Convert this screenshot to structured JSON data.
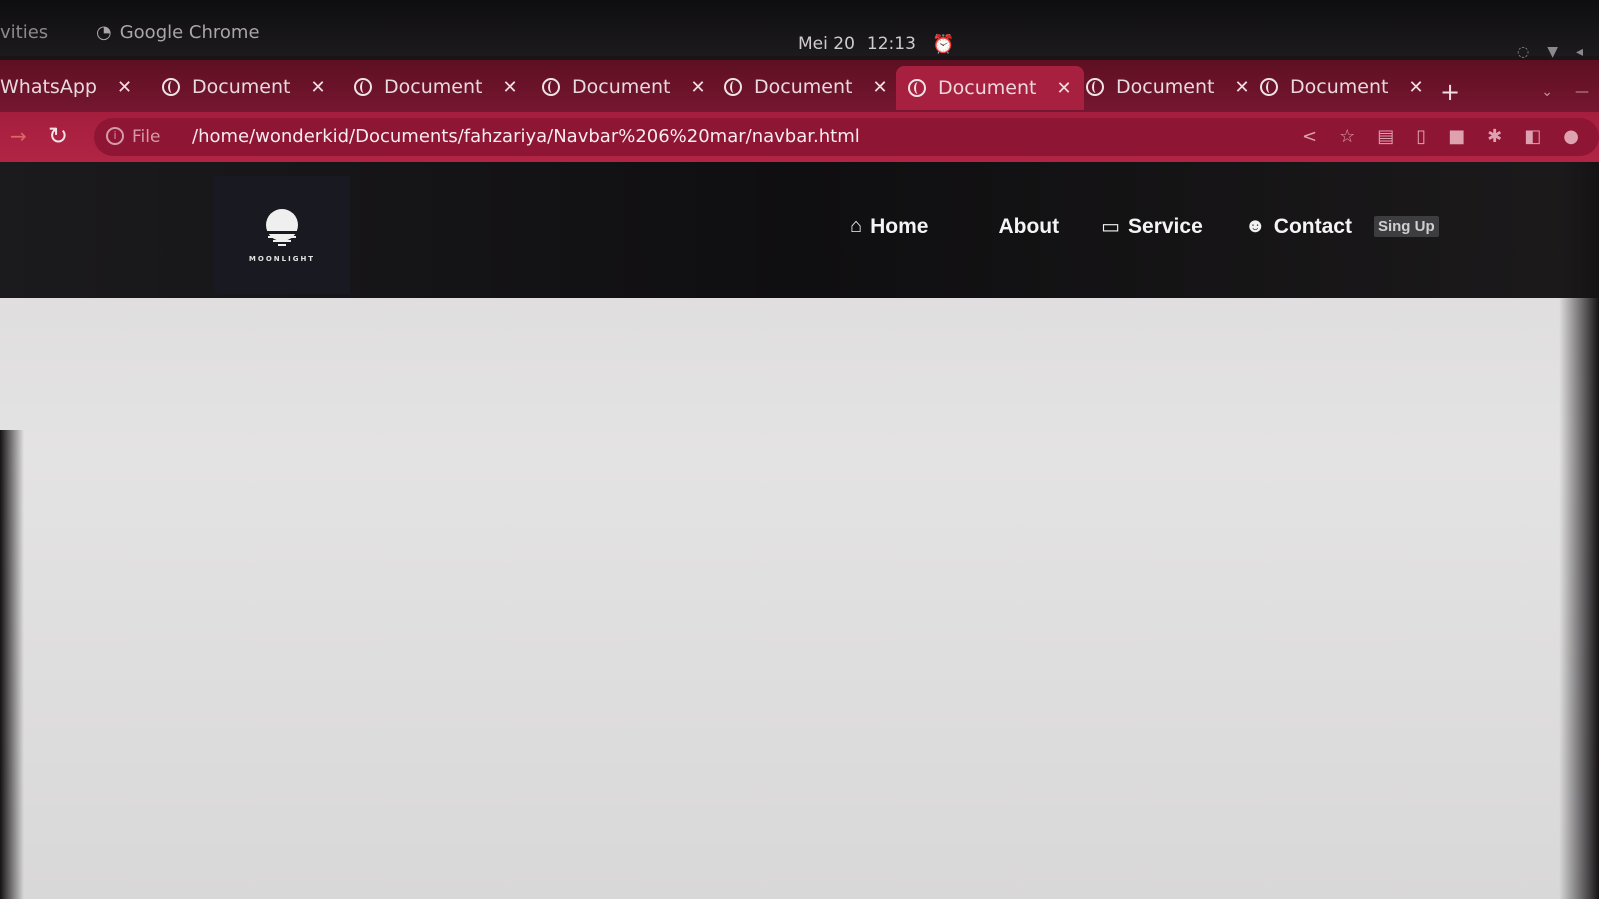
{
  "system_bar": {
    "activities": "vities",
    "app_name": "Google Chrome",
    "date": "Mei 20",
    "time": "12:13"
  },
  "tabs": [
    {
      "label": "WhatsApp",
      "active": false
    },
    {
      "label": "Document",
      "active": false
    },
    {
      "label": "Document",
      "active": false
    },
    {
      "label": "Document",
      "active": false
    },
    {
      "label": "Document",
      "active": false
    },
    {
      "label": "Document",
      "active": true
    },
    {
      "label": "Document",
      "active": false
    },
    {
      "label": "Document",
      "active": false
    }
  ],
  "address_bar": {
    "scheme_label": "File",
    "url": "/home/wonderkid/Documents/fahzariya/Navbar%206%20mar/navbar.html"
  },
  "site": {
    "logo_text": "MOONLIGHT",
    "nav": [
      {
        "label": "Home",
        "icon": "home-icon"
      },
      {
        "label": "About",
        "icon": ""
      },
      {
        "label": "Service",
        "icon": "briefcase-icon"
      },
      {
        "label": "Contact",
        "icon": "contact-icon"
      }
    ],
    "signup_label": "Sing Up"
  },
  "colors": {
    "browser_accent": "#a8203f",
    "navbar_bg": "#111012",
    "page_bg": "#e0dfdf"
  }
}
